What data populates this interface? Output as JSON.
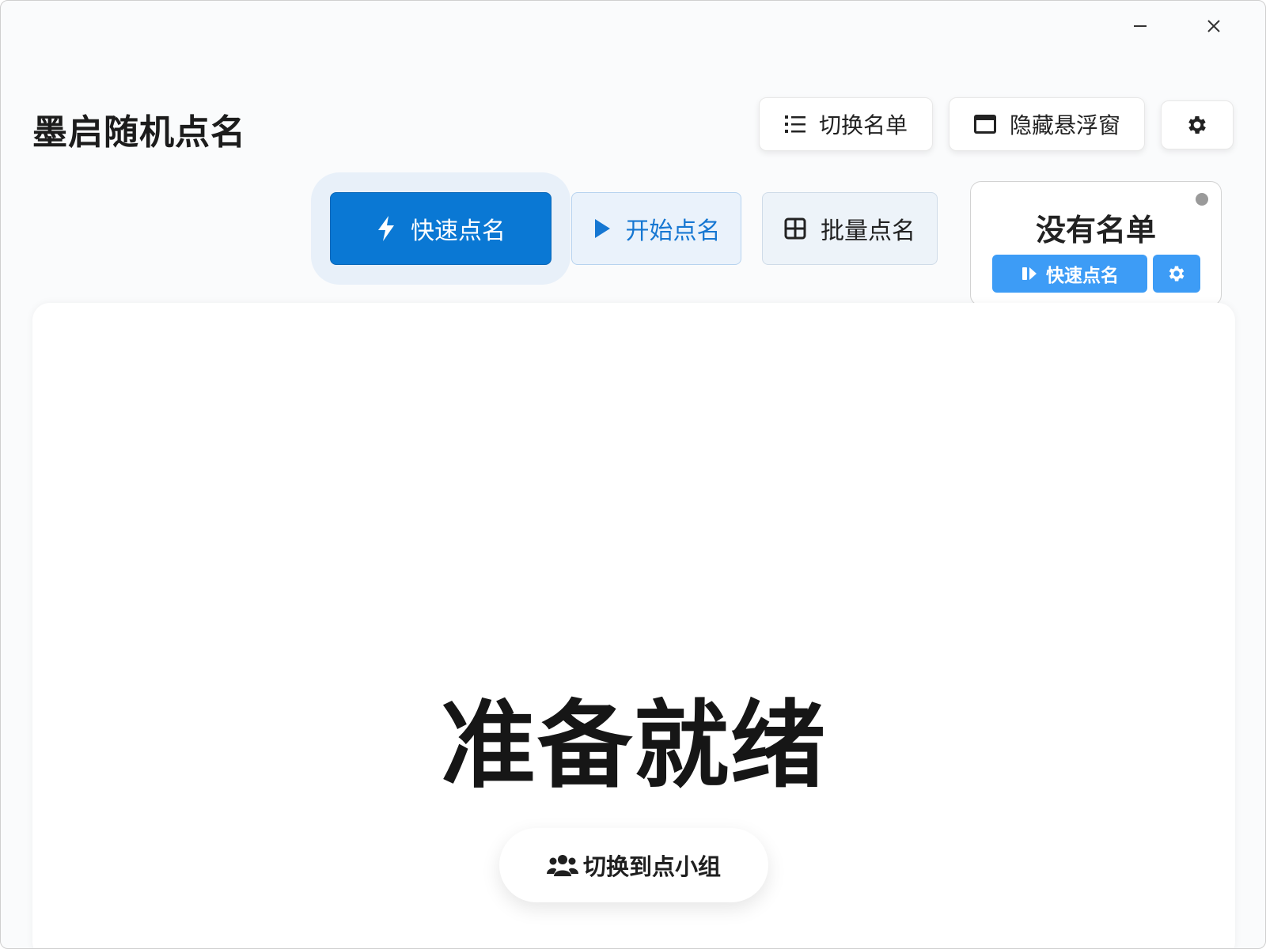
{
  "app": {
    "title": "墨启随机点名"
  },
  "window_controls": {
    "minimize_glyph": "–",
    "close_glyph": "✕"
  },
  "header": {
    "switch_list_label": "切换名单",
    "switch_list_icon": "list-icon",
    "hide_float_label": "隐藏悬浮窗",
    "hide_float_icon": "window-icon",
    "settings_icon": "gear-icon"
  },
  "modes": [
    {
      "label": "快速点名",
      "icon": "lightning-icon",
      "active": true
    },
    {
      "label": "开始点名",
      "icon": "play-icon",
      "active": false
    },
    {
      "label": "批量点名",
      "icon": "grid-icon",
      "active": false
    }
  ],
  "float_widget": {
    "title": "没有名单",
    "quick_label": "快速点名",
    "quick_icon": "pause-icon",
    "settings_icon": "gear-icon",
    "status_dot_color": "#9a9a9a"
  },
  "main": {
    "status_text": "准备就绪",
    "group_button_label": "切换到点小组",
    "group_button_icon": "users-icon"
  },
  "colors": {
    "accent": "#0a78d4",
    "accent_light": "#3d9cf6",
    "accent_text": "#1677d2"
  }
}
